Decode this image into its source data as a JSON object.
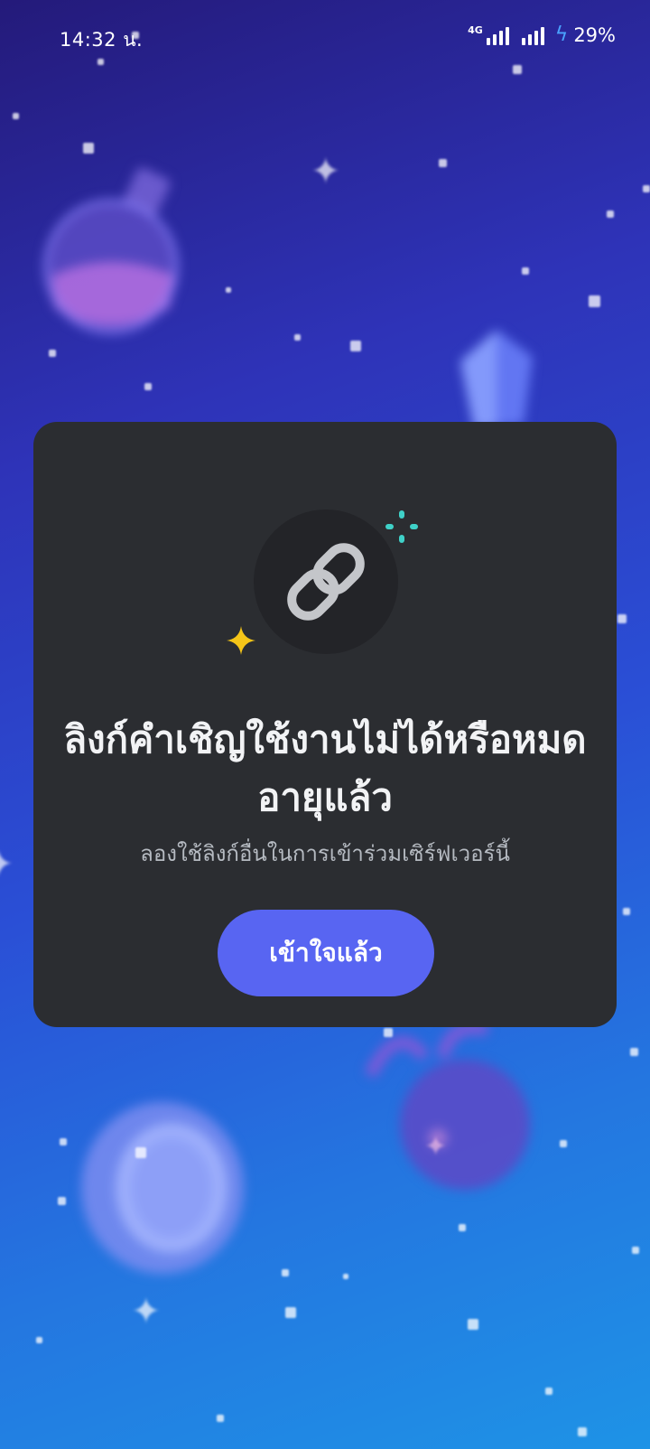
{
  "status_bar": {
    "time": "14:32 น.",
    "network": "4G",
    "battery_percent": "29%"
  },
  "dialog": {
    "icon": "link-icon",
    "title": "ลิงก์คำเชิญใช้งานไม่ได้หรือหมดอายุแล้ว",
    "subtitle": "ลองใช้ลิงก์อื่นในการเข้าร่วมเซิร์ฟเวอร์นี้",
    "button_label": "เข้าใจแล้ว"
  },
  "colors": {
    "modal_bg": "#2b2d31",
    "button": "#5865f2",
    "teal_sparkle": "#3fd1c8",
    "yellow_sparkle": "#f5c518"
  }
}
